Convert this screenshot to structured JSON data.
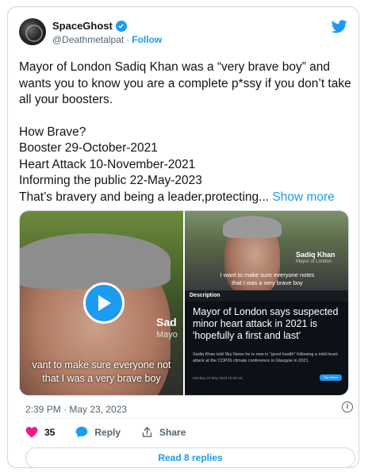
{
  "author": {
    "name": "SpaceGhost",
    "handle": "@Deathmetalpat",
    "separator": "·",
    "follow": "Follow"
  },
  "tweet": {
    "line1": "Mayor of London Sadiq Khan was a “very brave boy” and wants you to know you are a complete p*ssy if you don’t take all your boosters.",
    "line2": "How Brave?",
    "line3": "Booster 29-October-2021",
    "line4": "Heart Attack 10-November-2021",
    "line5": "Informing the public 22-May-2023",
    "line6": "That’s bravery and being a leader,protecting...",
    "show_more": "Show more"
  },
  "media": {
    "video": {
      "name": "Sad",
      "title": "Mayo",
      "caption_line1": "vant to make sure everyone not",
      "caption_line2": "that I was a very brave boy"
    },
    "image2": {
      "name": "Sadiq Khan",
      "title": "Mayor of London",
      "caption_line1": "I want to make sure everyone notes",
      "caption_line2": "that I was a very brave boy"
    },
    "image3": {
      "bar": "Description",
      "headline": "Mayor of London says suspected minor heart attack in 2021 is 'hopefully a first and last'",
      "article": "Sadiq Khan told Sky News he is now in \"good health\" following a mild heart attack at the COP26 climate conference in Glasgow in 2021.",
      "meta": "Monday 22 May 2023 10:25 UK",
      "button": "Sky News"
    }
  },
  "footer": {
    "timestamp": "2:39 PM · May 23, 2023",
    "info": "i",
    "likes": "35",
    "reply": "Reply",
    "share": "Share",
    "read_replies": "Read 8 replies"
  },
  "colors": {
    "accent": "#1d9bf0",
    "like": "#f91880",
    "text": "#0f1419",
    "secondary": "#536471"
  }
}
